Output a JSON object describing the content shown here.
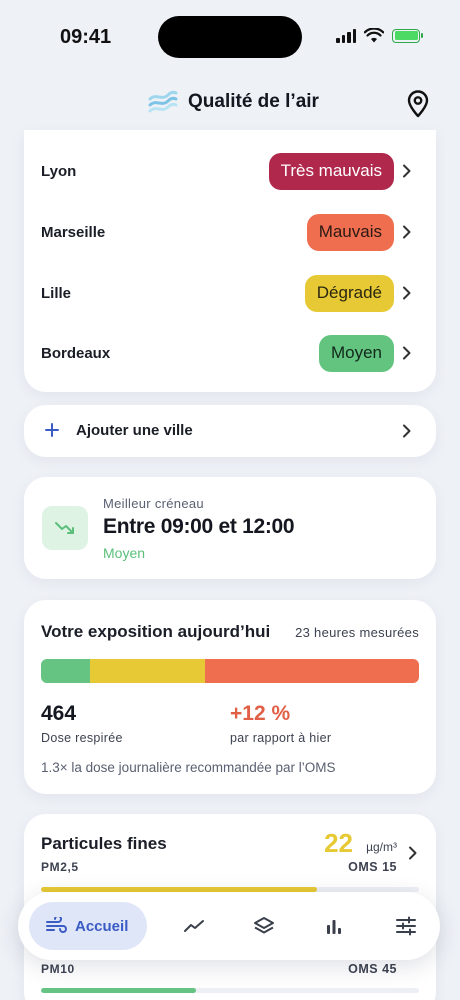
{
  "status_bar": {
    "time": "09:41"
  },
  "header": {
    "title": "Qualité de l’air"
  },
  "cities": [
    {
      "name": "Lyon",
      "level": "Très mauvais",
      "bg": "#b0284c",
      "fg": "#ffffff"
    },
    {
      "name": "Marseille",
      "level": "Mauvais",
      "bg": "#ef6e4f",
      "fg": "#2a1a14"
    },
    {
      "name": "Lille",
      "level": "Dégradé",
      "bg": "#e6c934",
      "fg": "#2a2610"
    },
    {
      "name": "Bordeaux",
      "level": "Moyen",
      "bg": "#63c480",
      "fg": "#12281a"
    }
  ],
  "add_city": {
    "label": "Ajouter une ville"
  },
  "best_slot": {
    "kicker": "Meilleur créneau",
    "time": "Entre 09:00 et 12:00",
    "level": "Moyen"
  },
  "exposure": {
    "title": "Votre exposition aujourd’hui",
    "measured": "23 heures mesurées",
    "segments": [
      {
        "fraction": 0.13,
        "color": "#66c483"
      },
      {
        "fraction": 0.305,
        "color": "#e6c934"
      },
      {
        "fraction": 0.565,
        "color": "#ef6e4f"
      }
    ],
    "dose_value": "464",
    "dose_label": "Dose respirée",
    "change_value": "+12 %",
    "change_label": "par rapport à hier",
    "note": "1.3× la dose journalière recommandée par l’OMS"
  },
  "pollutants": {
    "title": "Particules fines",
    "pm25": {
      "label": "PM2,5",
      "value": "22",
      "unit": "µg/m³",
      "oms": "OMS 15",
      "fill_fraction": 0.73,
      "color": "#e6c934"
    },
    "pm10": {
      "label": "PM10",
      "oms": "OMS 45",
      "fill_fraction": 0.41,
      "color": "#66c483"
    }
  },
  "tabbar": {
    "active_label": "Accueil"
  }
}
